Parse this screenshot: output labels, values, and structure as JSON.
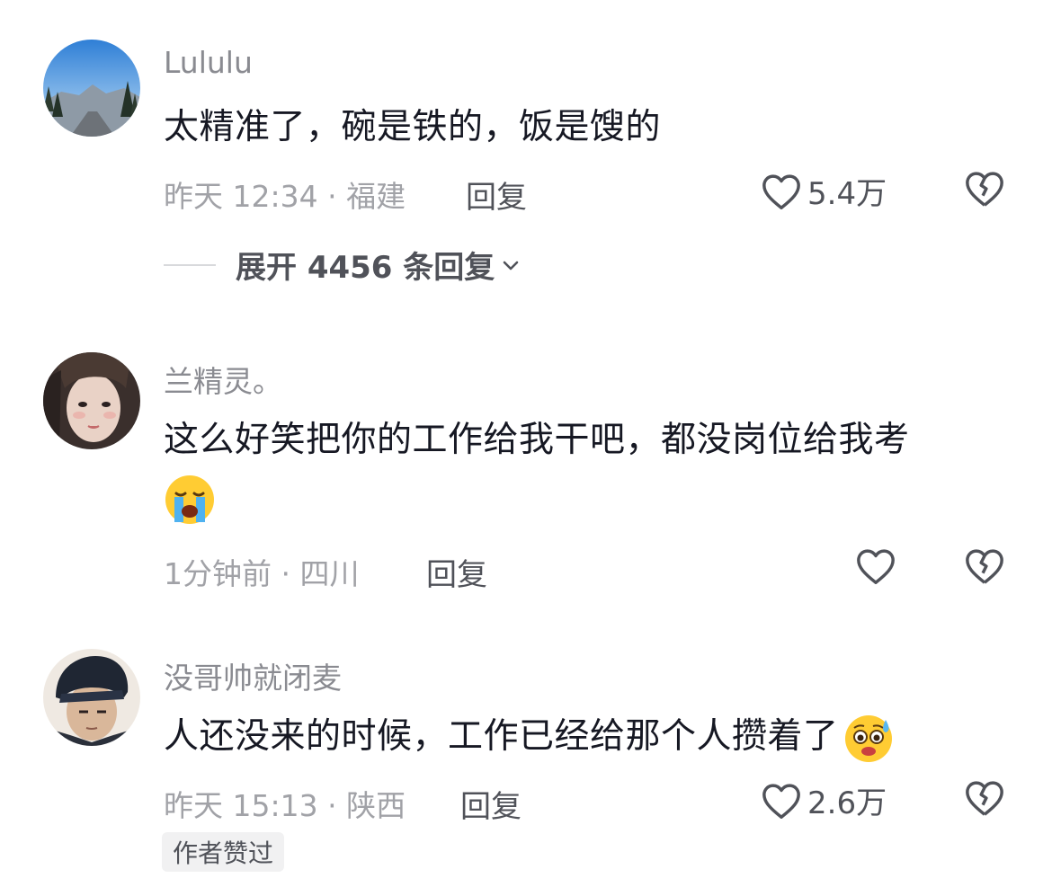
{
  "comments": [
    {
      "username": "Lululu",
      "content": "太精准了，碗是铁的，饭是馊的",
      "time": "昨天 12:34",
      "location": "福建",
      "reply_label": "回复",
      "likes": "5.4万",
      "expand_label": "展开 4456 条回复"
    },
    {
      "username": "兰精灵。",
      "content": "这么好笑把你的工作给我干吧，都没岗位给我考",
      "emoji": "loudly-crying-face-emoji",
      "time": "1分钟前",
      "location": "四川",
      "reply_label": "回复",
      "likes": ""
    },
    {
      "username": "没哥帅就闭麦",
      "content": "人还没来的时候，工作已经给那个人攒着了",
      "emoji": "anxious-sweat-face-emoji",
      "time": "昨天 15:13",
      "location": "陕西",
      "reply_label": "回复",
      "likes": "2.6万",
      "author_badge": "作者赞过"
    }
  ],
  "colors": {
    "text_primary": "#161823",
    "text_secondary": "#8a8b91",
    "text_meta": "#a1a2a7",
    "action": "#505259",
    "badge_bg": "#f1f1f2"
  },
  "icons": {
    "like": "heart-outline-icon",
    "dislike": "broken-heart-icon",
    "expand": "chevron-down-icon"
  }
}
